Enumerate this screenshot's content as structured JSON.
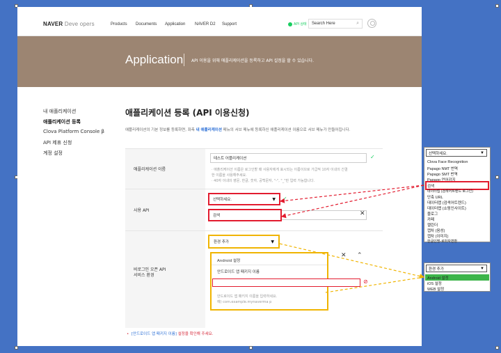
{
  "header": {
    "logo_bold": "NAVER",
    "logo_light": "Deve opers",
    "nav": [
      "Products",
      "Documents",
      "Application",
      "NAVER D2",
      "Support"
    ],
    "api_status": "API 상태",
    "search_label": "Search Here"
  },
  "banner": {
    "title": "Application",
    "desc": "API 이용을 위해 애플리케이션을 등록하고 API 설정을 할 수 있습니다."
  },
  "sidebar": {
    "items": [
      "내 애플리케이션",
      "애플리케이션 등록",
      "Clova Platform Console β",
      "API 제휴 신청",
      "계정 설정"
    ]
  },
  "main": {
    "title": "애플리케이션 등록 (API 이용신청)",
    "intro_1": "애플리케이션의 기본 정보를 등록하면, 좌측 ",
    "intro_link": "내 애플리케이션",
    "intro_2": " 메뉴의 서브 메뉴에 등록하신 애플리케이션 이름으로 서브 메뉴가 만들어집니다.",
    "app_name_label": "애플리케이션 이름",
    "app_name_value": "테스트 어플리케이션",
    "app_name_hint_1": "· 애플리케이션 이름은 로그인할 때 사용자에게 표시되는 이름이므로 가급적 10자 이내의 간결",
    "app_name_hint_2": "  한 이름을 사용해주세요.",
    "app_name_hint_3": "· 40자 이내의 영문, 한글, 숫자, 공백문자, \"-\", \"_\"만 입력 가능합니다.",
    "api_label": "사용 API",
    "api_select": "선택하세요.",
    "api_selected": "검색",
    "env_label_1": "비로그인 오픈 API",
    "env_label_2": "서비스 환경",
    "env_select": "환경 추가",
    "env_android": "Android 설정",
    "env_pkg_label": "안드로이드 앱 패키지 이름",
    "env_pkg_hint_1": "안드로이드 앱 패키지 이름을 입력하세요.",
    "env_pkg_hint_2": "예) com.example.mynaverma p",
    "warning_link": "[안드로이드 앱 패키지 이름]",
    "warning_text": " 설정을 확인해 주세요."
  },
  "api_dropdown": {
    "head": "선택하세요.",
    "options": [
      "Clova Face Recognition",
      "Papago NMT 번역",
      "Papago SMT 번역",
      "Papago 언어감지",
      "검색",
      "데이터랩 (검색어트렌드 로그인)",
      "단축 URL",
      "데이터랩 (검색어트렌드)",
      "데이터랩 (쇼핑인사이트)",
      "블로그",
      "카페",
      "캘린더",
      "캡차 (음성)",
      "캡차 (이미지)",
      "한글인명-로마자변환"
    ],
    "selected": "검색"
  },
  "env_dropdown": {
    "head": "환경 추가",
    "options": [
      "Android 설정",
      "iOS 설정",
      "WEB 설정"
    ],
    "selected": "Android 설정"
  },
  "colors": {
    "background": "#4472c4",
    "banner": "#9c8572",
    "naver_green": "#19ce60",
    "highlight_red": "#e21b2e",
    "highlight_yellow": "#f0b400",
    "selected_green": "#3db54a"
  }
}
